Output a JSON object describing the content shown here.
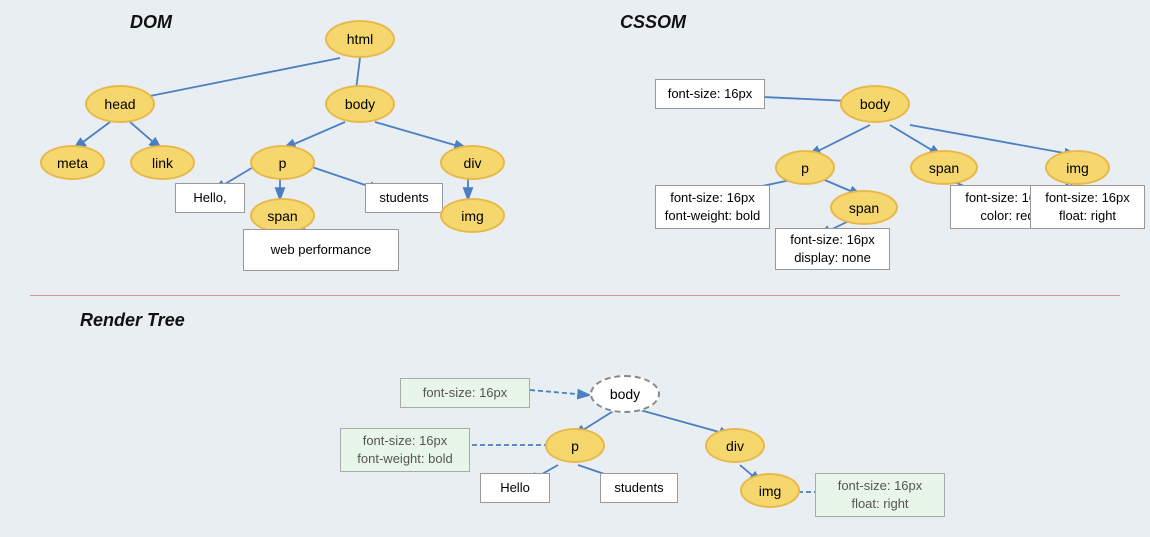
{
  "sections": {
    "dom_label": "DOM",
    "cssom_label": "CSSOM",
    "render_label": "Render Tree"
  },
  "dom": {
    "nodes": {
      "html": "html",
      "head": "head",
      "body": "body",
      "meta": "meta",
      "link": "link",
      "p": "p",
      "span": "span",
      "div": "div",
      "img": "img"
    },
    "text_nodes": {
      "hello": "Hello,",
      "web_performance": "web performance",
      "students": "students"
    }
  },
  "cssom": {
    "nodes": {
      "body": "body",
      "p": "p",
      "span_child": "span",
      "span": "span",
      "img": "img"
    },
    "rects": {
      "font_size_body": "font-size: 16px",
      "p_styles": "font-size: 16px\nfont-weight: bold",
      "span_inner": "font-size: 16px\ndisplay: none",
      "span_styles": "font-size: 16px\ncolor: red",
      "img_styles": "font-size: 16px\nfloat: right"
    }
  },
  "render": {
    "nodes": {
      "body": "body",
      "p": "p",
      "div": "div",
      "img": "img"
    },
    "rects": {
      "font_size": "font-size: 16px",
      "p_styles": "font-size: 16px\nfont-weight: bold",
      "img_styles": "font-size: 16px\nfloat: right"
    },
    "text_nodes": {
      "hello": "Hello",
      "students": "students"
    }
  },
  "colors": {
    "oval_fill": "#f5d76e",
    "oval_border": "#e8b84b",
    "rect_fill": "#ffffff",
    "arrow_color": "#4a7fc1",
    "divider_color": "#c0392b"
  }
}
